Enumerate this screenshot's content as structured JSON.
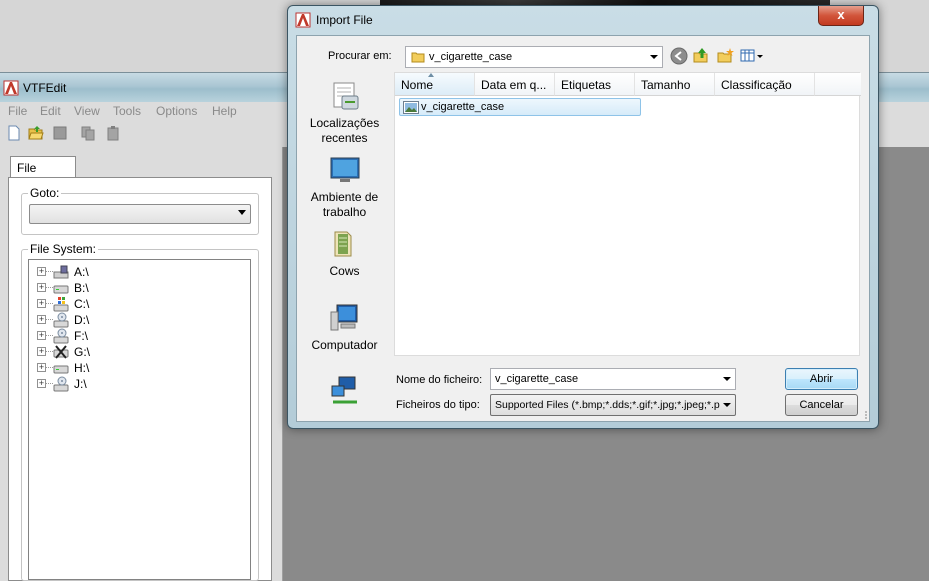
{
  "vtfedit": {
    "title": "VTFEdit",
    "menu": [
      "File",
      "Edit",
      "View",
      "Tools",
      "Options",
      "Help"
    ],
    "toolbar_icons": [
      "new-file-icon",
      "open-folder-icon",
      "save-icon",
      "copy-icon",
      "paste-icon"
    ],
    "tab_label": "File System",
    "goto_label": "Goto:",
    "goto_value": "",
    "filesystem_label": "File System:",
    "drives": [
      {
        "label": "A:\\",
        "icon": "floppy-drive-icon"
      },
      {
        "label": "B:\\",
        "icon": "drive-icon"
      },
      {
        "label": "C:\\",
        "icon": "windows-drive-icon"
      },
      {
        "label": "D:\\",
        "icon": "cd-drive-icon"
      },
      {
        "label": "F:\\",
        "icon": "cd-drive-icon"
      },
      {
        "label": "G:\\",
        "icon": "network-drive-icon"
      },
      {
        "label": "H:\\",
        "icon": "drive-icon"
      },
      {
        "label": "J:\\",
        "icon": "cd-drive-icon"
      }
    ]
  },
  "dialog": {
    "title": "Import File",
    "close_label": "x",
    "look_in_label": "Procurar em:",
    "look_in_value": "v_cigarette_case",
    "places": [
      {
        "label": "Localizações recentes",
        "icon": "recent-places-icon"
      },
      {
        "label": "Ambiente de trabalho",
        "icon": "desktop-icon"
      },
      {
        "label": "Cows",
        "icon": "user-folder-icon"
      },
      {
        "label": "Computador",
        "icon": "computer-icon"
      },
      {
        "label": "",
        "icon": "network-icon"
      }
    ],
    "columns": [
      "Nome",
      "Data em q...",
      "Etiquetas",
      "Tamanho",
      "Classificação"
    ],
    "files": [
      {
        "name": "v_cigarette_case",
        "icon": "image-file-icon"
      }
    ],
    "filename_label": "Nome do ficheiro:",
    "filename_value": "v_cigarette_case",
    "filetype_label": "Ficheiros do tipo:",
    "filetype_value": "Supported Files (*.bmp;*.dds;*.gif;*.jpg;*.jpeg;*.p",
    "open_button": "Abrir",
    "cancel_button": "Cancelar"
  }
}
